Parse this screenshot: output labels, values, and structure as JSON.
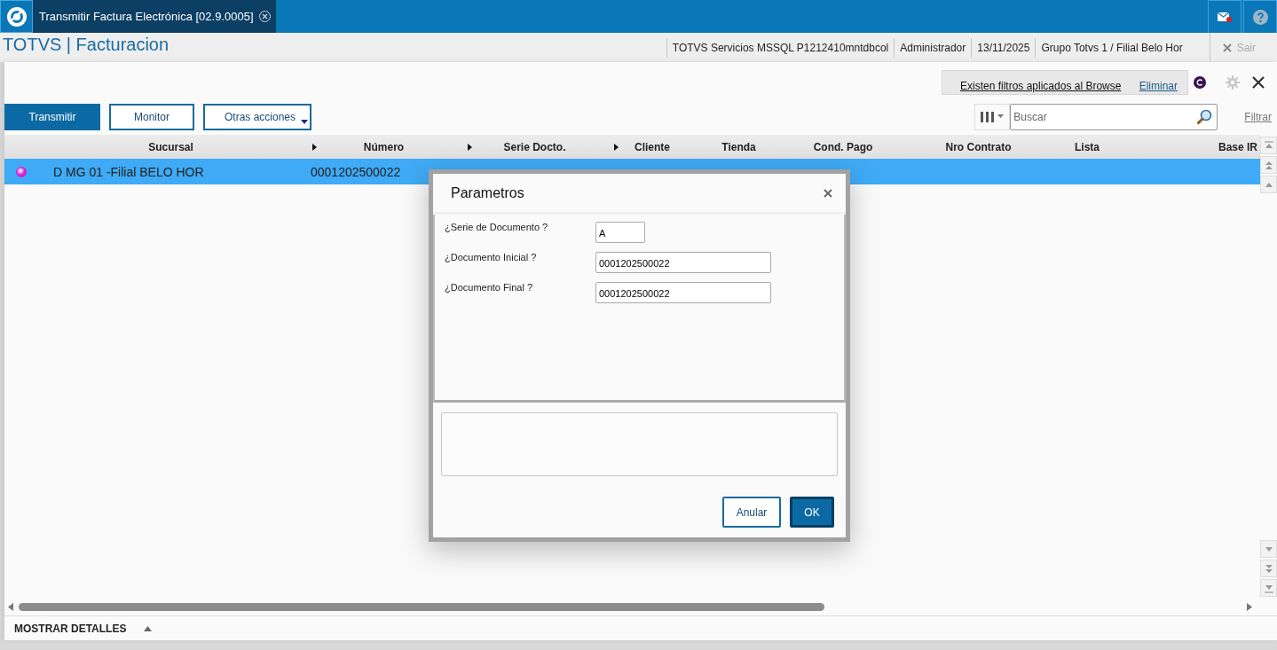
{
  "app_bar": {
    "tab": {
      "title": "Transmitir Factura Electrónica [02.9.0005]",
      "selected": true
    }
  },
  "header": {
    "title": "TOTVS | Facturacion",
    "info": [
      "TOTVS Servicios MSSQL P1212410mntdbcol",
      "Administrador",
      "13/11/2025",
      "Grupo Totvs 1 / Filial Belo Hor"
    ],
    "exit": {
      "label": "Sair",
      "disabled": true
    }
  },
  "filter_notice": {
    "text": "Existen filtros aplicados al Browse",
    "action": "Eliminar"
  },
  "actions": [
    {
      "label": "Transmitir",
      "kind": "primary"
    },
    {
      "label": "Monitor",
      "kind": "secondary"
    },
    {
      "label": "Otras acciones",
      "kind": "menu"
    }
  ],
  "search": {
    "placeholder": "Buscar"
  },
  "filter_link": "Filtrar",
  "table": {
    "columns": [
      {
        "label": "Sucursal",
        "arrow": false
      },
      {
        "label": "Número",
        "arrow": true
      },
      {
        "label": "Serie Docto.",
        "arrow": true
      },
      {
        "label": "Cliente",
        "arrow": true
      },
      {
        "label": "Tienda",
        "arrow": false
      },
      {
        "label": "Cond. Pago",
        "arrow": false
      },
      {
        "label": "Nro Contrato",
        "arrow": false
      },
      {
        "label": "Lista",
        "arrow": false
      },
      {
        "label": "Base IR",
        "arrow": false
      }
    ],
    "rows": [
      {
        "selected": true,
        "color": "#d21fd2",
        "cells": [
          "D MG 01 -Filial BELO HOR",
          "0001202500022"
        ]
      }
    ]
  },
  "footer": {
    "label": "MOSTRAR DETALLES",
    "expanded": false
  },
  "dialog": {
    "title": "Parametros",
    "fields": [
      {
        "label": "¿Serie de Documento ?",
        "value": "A",
        "kind": "short"
      },
      {
        "label": "¿Documento Inicial ?",
        "value": "0001202500022",
        "kind": "long"
      },
      {
        "label": "¿Documento Final ?",
        "value": "0001202500022",
        "kind": "long"
      }
    ],
    "buttons": [
      {
        "label": "Anular",
        "kind": "secondary"
      },
      {
        "label": "OK",
        "kind": "primary"
      }
    ]
  }
}
